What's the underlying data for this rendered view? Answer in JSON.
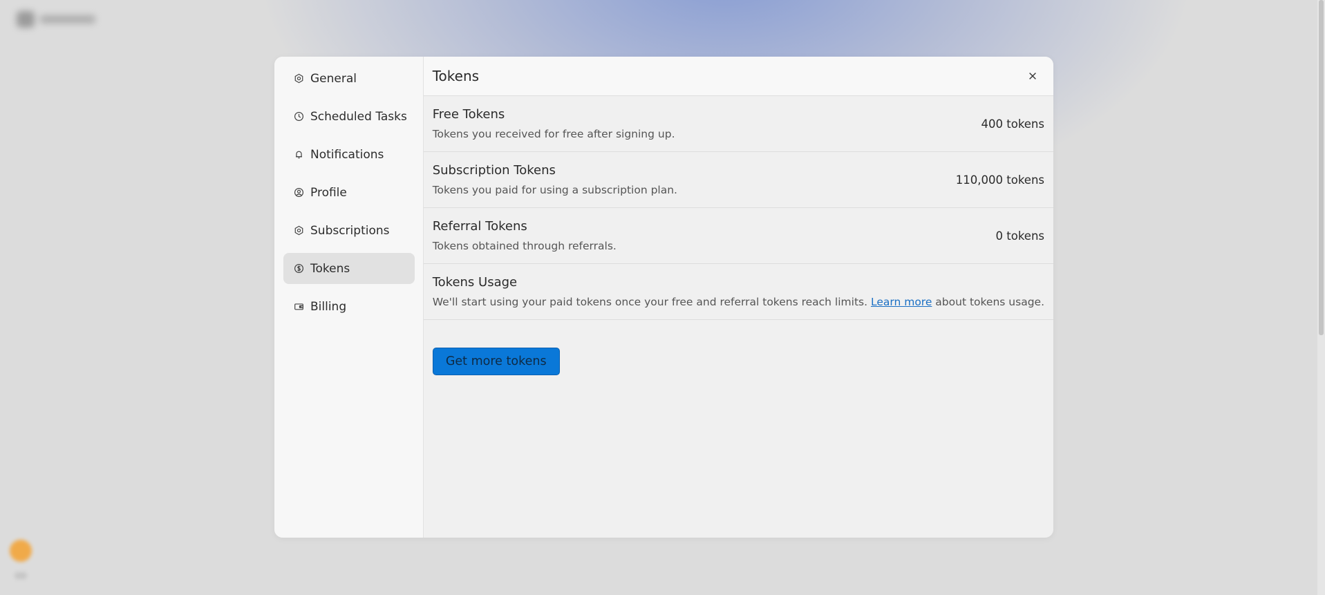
{
  "colors": {
    "accent": "#0a78d8",
    "link": "#1a6fc4",
    "backdrop_gradient": "#7891d2",
    "fab": "#f3a53a"
  },
  "sidebar": {
    "items": [
      {
        "label": "General",
        "icon": "settings-icon",
        "active": false
      },
      {
        "label": "Scheduled Tasks",
        "icon": "clock-icon",
        "active": false
      },
      {
        "label": "Notifications",
        "icon": "bell-icon",
        "active": false
      },
      {
        "label": "Profile",
        "icon": "user-circle-icon",
        "active": false
      },
      {
        "label": "Subscriptions",
        "icon": "settings-icon",
        "active": false
      },
      {
        "label": "Tokens",
        "icon": "dollar-coin-icon",
        "active": true
      },
      {
        "label": "Billing",
        "icon": "wallet-icon",
        "active": false
      }
    ]
  },
  "main": {
    "title": "Tokens",
    "close_icon": "close-icon",
    "rows": [
      {
        "title": "Free Tokens",
        "description": "Tokens you received for free after signing up.",
        "value": "400 tokens"
      },
      {
        "title": "Subscription Tokens",
        "description": "Tokens you paid for using a subscription plan.",
        "value": "110,000 tokens"
      },
      {
        "title": "Referral Tokens",
        "description": "Tokens obtained through referrals.",
        "value": "0 tokens"
      }
    ],
    "usage": {
      "title": "Tokens Usage",
      "text_before": "We'll start using your paid tokens once your free and referral tokens reach limits. ",
      "link_text": "Learn more",
      "text_after": " about tokens usage."
    },
    "cta_label": "Get more tokens"
  }
}
